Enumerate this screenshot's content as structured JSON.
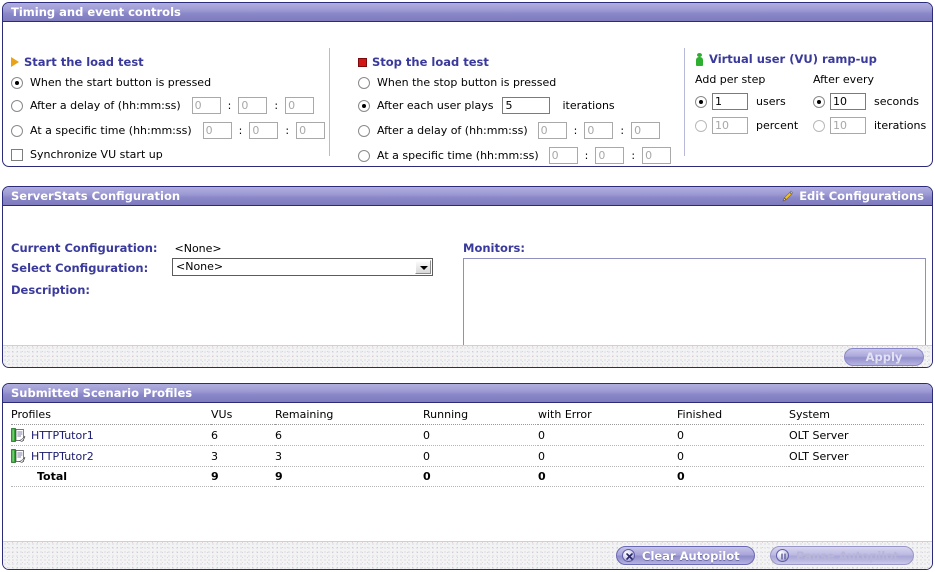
{
  "timing_panel": {
    "title": "Timing and event controls",
    "start_group": {
      "heading": "Start the load test",
      "icon": "play-icon",
      "options": [
        {
          "label": "When the start button is pressed",
          "checked": true
        },
        {
          "label": "After a delay of (hh:mm:ss)",
          "checked": false,
          "fields": [
            "0",
            "0",
            "0"
          ]
        },
        {
          "label": "At a specific time (hh:mm:ss)",
          "checked": false,
          "fields": [
            "0",
            "0",
            "0"
          ]
        }
      ],
      "checkbox": {
        "label": "Synchronize VU start up",
        "checked": false
      }
    },
    "stop_group": {
      "heading": "Stop the load test",
      "icon": "stop-icon",
      "options": [
        {
          "label": "When the stop button is pressed",
          "checked": false
        },
        {
          "label": "After each user plays",
          "checked": true,
          "value": "5",
          "suffix": "iterations"
        },
        {
          "label": "After a delay of (hh:mm:ss)",
          "checked": false,
          "fields": [
            "0",
            "0",
            "0"
          ]
        },
        {
          "label": "At a specific time (hh:mm:ss)",
          "checked": false,
          "fields": [
            "0",
            "0",
            "0"
          ]
        }
      ]
    },
    "vu_group": {
      "heading": "Virtual user (VU) ramp-up",
      "icon": "person-icon",
      "col1_header": "Add per step",
      "col2_header": "After every",
      "rows": [
        {
          "left": {
            "checked": true,
            "value": "1",
            "label": "users",
            "disabled": false
          },
          "right": {
            "checked": true,
            "value": "10",
            "label": "seconds",
            "disabled": false
          }
        },
        {
          "left": {
            "checked": false,
            "value": "10",
            "label": "percent",
            "disabled": true
          },
          "right": {
            "checked": false,
            "value": "10",
            "label": "iterations",
            "disabled": true
          }
        }
      ]
    }
  },
  "serverstats_panel": {
    "title": "ServerStats Configuration",
    "edit_link": "Edit Configurations",
    "edit_icon": "pencil-icon",
    "current_config_label": "Current Configuration:",
    "current_config_value": "<None>",
    "select_config_label": "Select Configuration:",
    "select_config_value": "<None>",
    "description_label": "Description:",
    "description_value": "",
    "monitors_label": "Monitors:",
    "monitors_value": "",
    "apply_label": "Apply"
  },
  "profiles_panel": {
    "title": "Submitted Scenario Profiles",
    "columns": [
      "Profiles",
      "VUs",
      "Remaining",
      "Running",
      "with Error",
      "Finished",
      "System"
    ],
    "rows": [
      {
        "icon": "script-icon",
        "profile": "HTTPTutor1",
        "vus": "6",
        "remaining": "6",
        "running": "0",
        "with_error": "0",
        "finished": "0",
        "system": "OLT Server"
      },
      {
        "icon": "script-icon",
        "profile": "HTTPTutor2",
        "vus": "3",
        "remaining": "3",
        "running": "0",
        "with_error": "0",
        "finished": "0",
        "system": "OLT Server"
      }
    ],
    "total_row": {
      "profile": "Total",
      "vus": "9",
      "remaining": "9",
      "running": "0",
      "with_error": "0",
      "finished": "0",
      "system": ""
    }
  },
  "footer": {
    "clear_button": {
      "label": "Clear Autopilot",
      "icon": "cancel-circle-icon",
      "disabled": false
    },
    "pause_button": {
      "label": "Pause Autopilot",
      "icon": "pause-circle-icon",
      "disabled": true
    }
  },
  "colors": {
    "title_bar": "#9e9bd4",
    "panel_border": "#2b2b7a",
    "heading_text": "#3a3a9c",
    "link_text": "#1a1a6e",
    "start_icon": "#e8a317",
    "stop_icon": "#d41515",
    "vu_icon": "#2faf2f"
  }
}
